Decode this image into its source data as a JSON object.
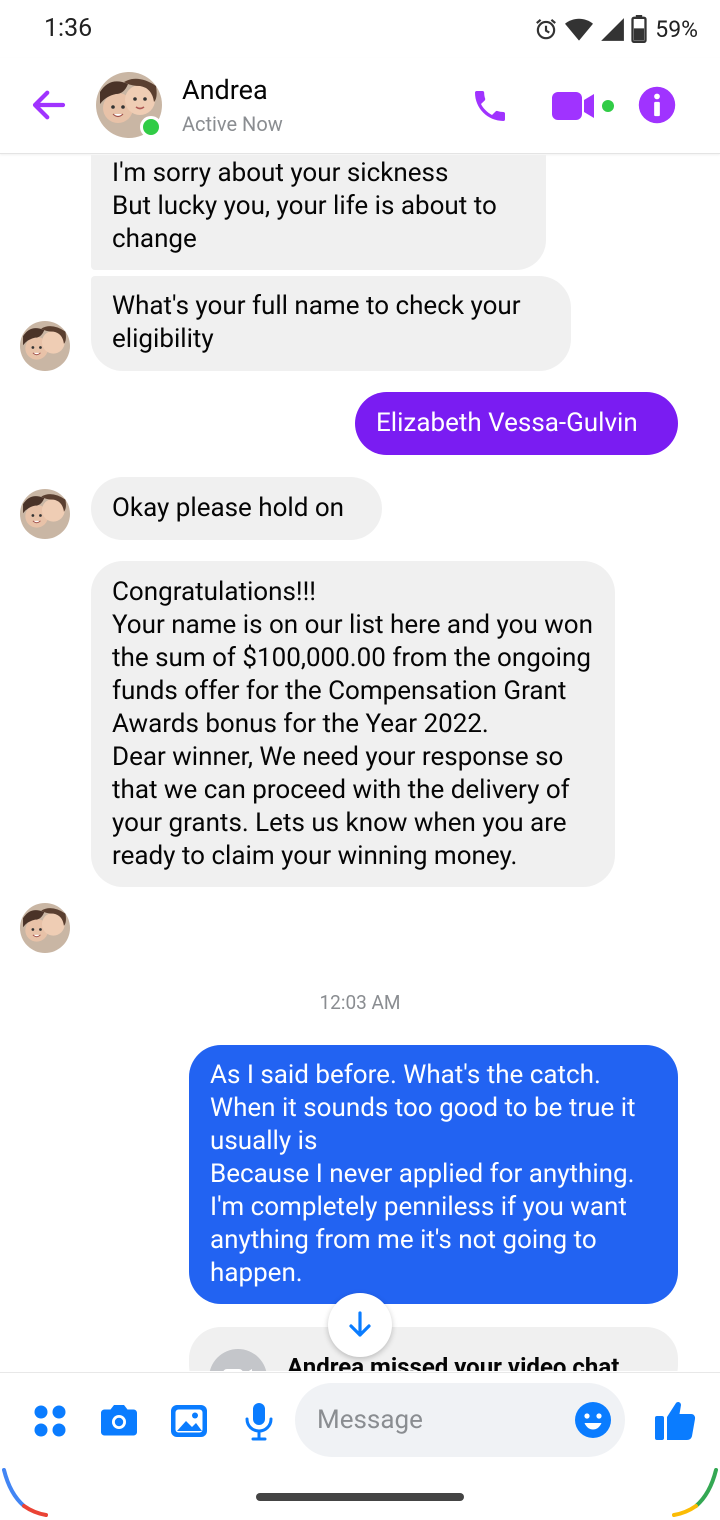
{
  "status_bar": {
    "time": "1:36",
    "battery": "59%"
  },
  "header": {
    "contact_name": "Andrea",
    "contact_status": "Active Now"
  },
  "messages": [
    {
      "text": "I'm sorry about your sickness\nBut lucky you, your life is about to change"
    },
    {
      "text": "What's your full name to check your eligibility"
    },
    {
      "text": "Elizabeth Vessa-Gulvin"
    },
    {
      "text": "Okay please hold on"
    },
    {
      "text": "Congratulations!!!\nYour name  is on our list here and you won the sum of $100,000.00 from the ongoing funds offer for the Compensation Grant Awards bonus for the Year 2022.\nDear winner, We need your response so that we can proceed with the delivery of your grants. Lets us know when you are ready to claim your winning money."
    },
    {
      "text": "As I said before. What's the catch. When it sounds too good to be true it usually is\n Because I never applied for anything. I'm completely penniless if you want anything from me it's not going to happen."
    }
  ],
  "timestamp": "12:03 AM",
  "missed_call": {
    "text": "Andrea missed your video chat."
  },
  "composer": {
    "placeholder": "Message"
  },
  "colors": {
    "accent_purple": "#a033ff",
    "bubble_purple": "#7a1cf2",
    "bubble_blue": "#2263f2",
    "composer_blue": "#0a7cff",
    "online_green": "#31cc46"
  },
  "icons": [
    "back-arrow-icon",
    "phone-icon",
    "video-camera-icon",
    "info-icon",
    "scroll-down-arrow-icon",
    "menu-dots-icon",
    "camera-icon",
    "gallery-icon",
    "microphone-icon",
    "emoji-icon",
    "thumbs-up-icon"
  ]
}
